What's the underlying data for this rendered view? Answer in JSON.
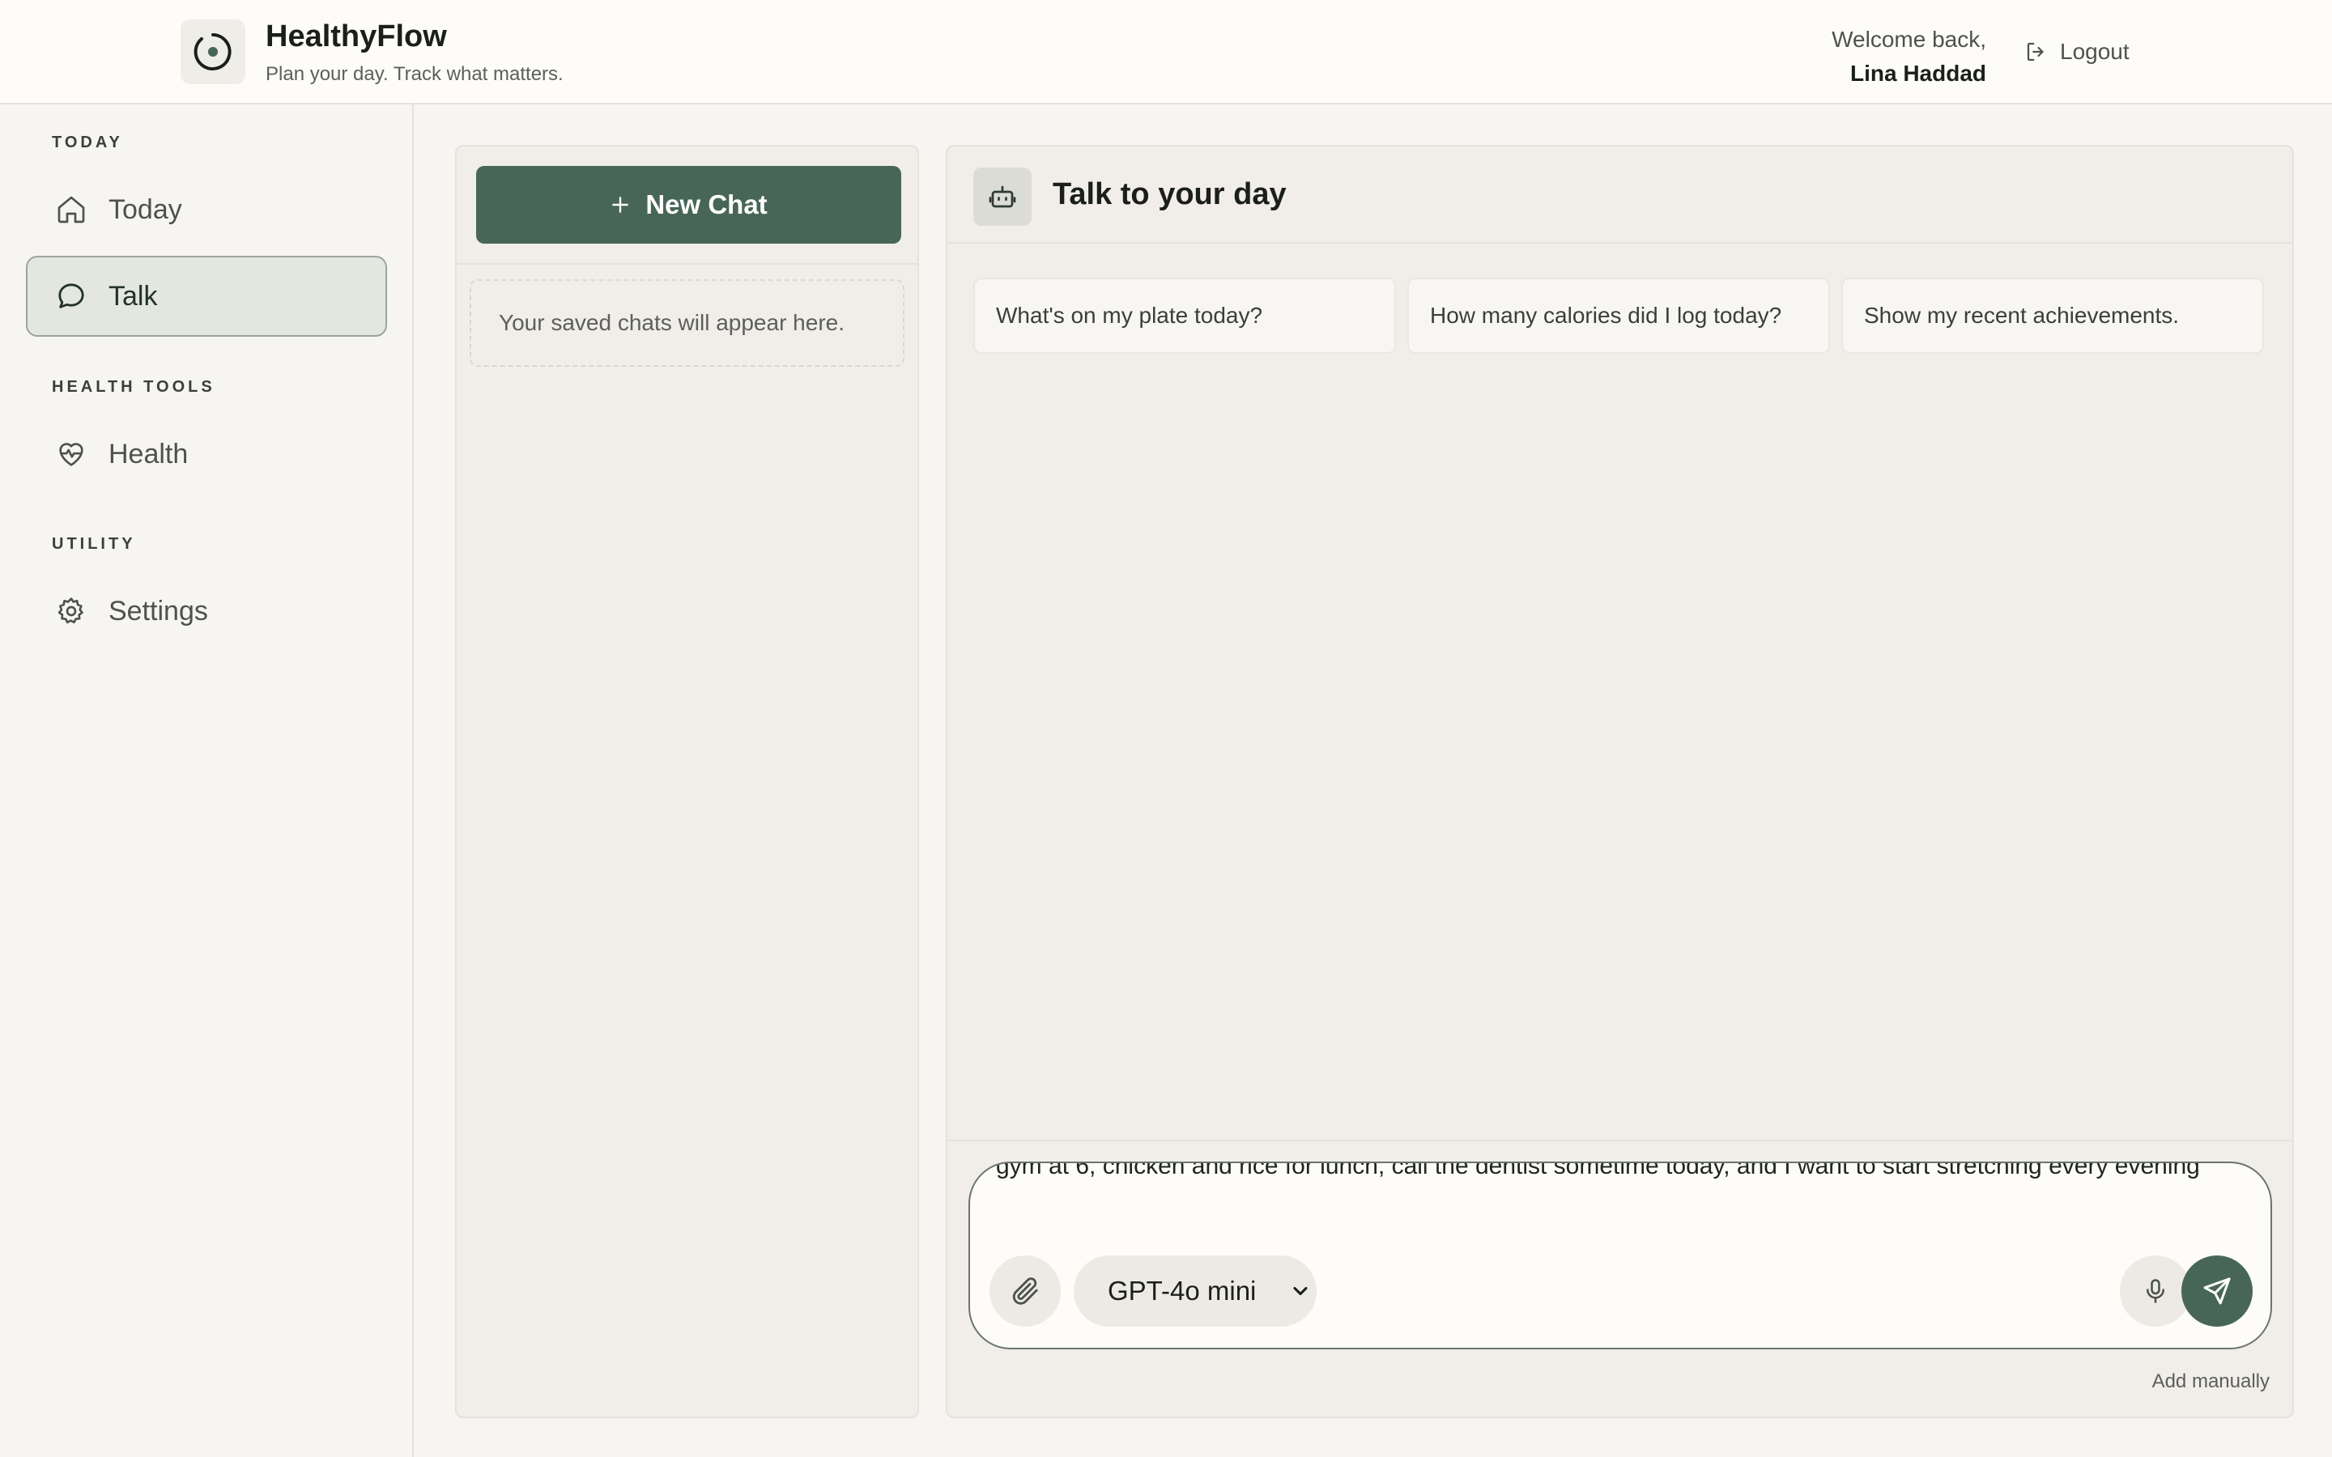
{
  "app": {
    "name": "HealthyFlow",
    "tagline": "Plan your day. Track what matters."
  },
  "header": {
    "welcome": "Welcome back,",
    "user_name": "Lina Haddad",
    "logout_label": "Logout"
  },
  "sidebar": {
    "sections": [
      {
        "label": "TODAY",
        "items": [
          {
            "label": "Today",
            "icon": "home-icon"
          },
          {
            "label": "Talk",
            "icon": "chat-bubble-icon",
            "active": true
          }
        ]
      },
      {
        "label": "HEALTH TOOLS",
        "items": [
          {
            "label": "Health",
            "icon": "heart-pulse-icon"
          }
        ]
      },
      {
        "label": "UTILITY",
        "items": [
          {
            "label": "Settings",
            "icon": "gear-icon"
          }
        ]
      }
    ]
  },
  "chat_list": {
    "new_chat_label": "New Chat",
    "empty_note": "Your saved chats will appear here."
  },
  "main": {
    "title": "Talk to your day",
    "suggestions": [
      "What's on my plate today?",
      "How many calories did I log today?",
      "Show my recent achievements."
    ],
    "composer": {
      "text": "gym at 6, chicken and rice for lunch, call the dentist sometime today, and I want to start stretching every evening",
      "model": "GPT-4o mini"
    },
    "add_manually_label": "Add manually"
  },
  "colors": {
    "accent": "#476658",
    "background": "#f6f5f1",
    "panel": "#f1ede8"
  }
}
